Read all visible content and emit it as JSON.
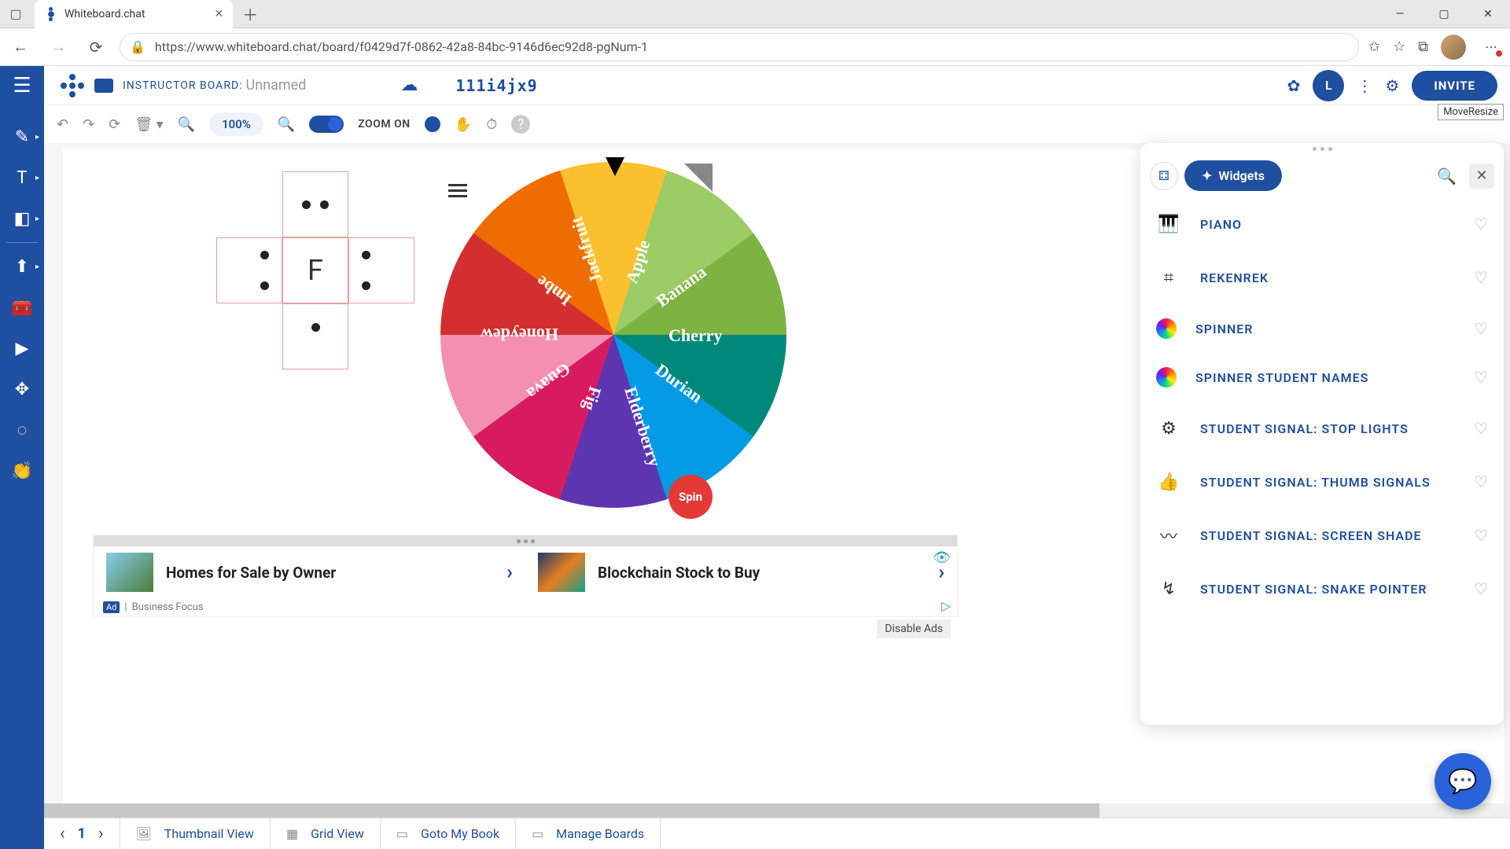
{
  "browser": {
    "tab_title": "Whiteboard.chat",
    "url": "https://www.whiteboard.chat/board/f0429d7f-0862-42a8-84bc-9146d6ec92d8-pgNum-1"
  },
  "header": {
    "board_label": "INSTRUCTOR BOARD:",
    "board_name": "Unnamed",
    "room_code": "111i4jx9",
    "user_initial": "L",
    "invite_label": "INVITE"
  },
  "toolbar": {
    "zoom_pct": "100%",
    "zoom_label": "ZOOM ON",
    "move_resize": "MoveResize"
  },
  "dice": {
    "center_letter": "F"
  },
  "spinner": {
    "button_label": "Spin",
    "slices": [
      {
        "label": "Apple",
        "color": "#d32f2f"
      },
      {
        "label": "Banana",
        "color": "#ef6c00"
      },
      {
        "label": "Cherry",
        "color": "#fbc02d"
      },
      {
        "label": "Durian",
        "color": "#9ccc65"
      },
      {
        "label": "Elderberry",
        "color": "#7cb342"
      },
      {
        "label": "Fig",
        "color": "#00897b"
      },
      {
        "label": "Guava",
        "color": "#039be5"
      },
      {
        "label": "Honeydew",
        "color": "#5e35b1"
      },
      {
        "label": "Imbe",
        "color": "#d81b60"
      },
      {
        "label": "Jackfruit",
        "color": "#f48fb1"
      }
    ]
  },
  "widgets_panel": {
    "tab_label": "Widgets",
    "items": [
      {
        "label": "PIANO",
        "icon": "piano"
      },
      {
        "label": "REKENREK",
        "icon": "abacus"
      },
      {
        "label": "SPINNER",
        "icon": "rainbow"
      },
      {
        "label": "SPINNER STUDENT NAMES",
        "icon": "rainbow"
      },
      {
        "label": "STUDENT SIGNAL: STOP LIGHTS",
        "icon": "gear"
      },
      {
        "label": "STUDENT SIGNAL: THUMB SIGNALS",
        "icon": "thumb"
      },
      {
        "label": "STUDENT SIGNAL: SCREEN SHADE",
        "icon": "wave"
      },
      {
        "label": "STUDENT SIGNAL: SNAKE POINTER",
        "icon": "route"
      }
    ]
  },
  "ads": {
    "card1_title": "Homes for Sale by Owner",
    "card2_title": "Blockchain Stock to Buy",
    "footer_text": "Business Focus",
    "badge": "Ad",
    "disable_label": "Disable Ads"
  },
  "bottom_bar": {
    "page_num": "1",
    "thumbnail": "Thumbnail View",
    "grid": "Grid View",
    "goto": "Goto My Book",
    "manage": "Manage Boards"
  }
}
